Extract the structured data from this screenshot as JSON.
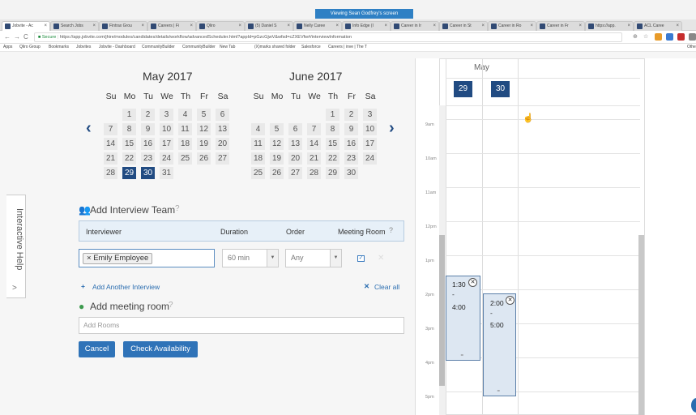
{
  "screen_share": {
    "label": "Viewing Sean Godfrey's screen"
  },
  "browser": {
    "tabs": [
      {
        "title": "Jobvite - Ac",
        "active": true
      },
      {
        "title": "Search Jobs",
        "active": false
      },
      {
        "title": "Fintrax Grou",
        "active": false
      },
      {
        "title": "Careers | Fi",
        "active": false
      },
      {
        "title": "Qliro",
        "active": false
      },
      {
        "title": "(5) Daniel S",
        "active": false
      },
      {
        "title": "Nelly Caree",
        "active": false
      },
      {
        "title": "Info Edge (I",
        "active": false
      },
      {
        "title": "Career in Ir",
        "active": false
      },
      {
        "title": "Career in St",
        "active": false
      },
      {
        "title": "Career in Ro",
        "active": false
      },
      {
        "title": "Career in Fr",
        "active": false
      },
      {
        "title": "https://app.",
        "active": false
      },
      {
        "title": "ACL Caree",
        "active": false
      }
    ],
    "secure_label": "Secure",
    "url": "https://app.jobvite.com/jhire/modules/candidates/details/workflow/advancedScheduler.html?appId=pGzcGjwV&wfsd=cZXEVfw#/interviewInformation",
    "bookmarks": [
      "Apps",
      "Qliro Group",
      "Bookmarks",
      "Jobvites",
      "Jobvite - Dashboard",
      "CommunityBuilder",
      "CommunityBuilder",
      "New Tab",
      "(X)marks shared folder",
      "Salesforce",
      "Careers | inve | The T",
      "Other"
    ]
  },
  "help_tab": {
    "label": "Interactive Help",
    "chevron": ">"
  },
  "calendar": {
    "prev_icon": "‹",
    "next_icon": "›",
    "weekdays": [
      "Su",
      "Mo",
      "Tu",
      "We",
      "Th",
      "Fr",
      "Sa"
    ],
    "months": [
      {
        "title": "May 2017",
        "weeks": [
          [
            "",
            "1",
            "2",
            "3",
            "4",
            "5",
            "6"
          ],
          [
            "7",
            "8",
            "9",
            "10",
            "11",
            "12",
            "13"
          ],
          [
            "14",
            "15",
            "16",
            "17",
            "18",
            "19",
            "20"
          ],
          [
            "21",
            "22",
            "23",
            "24",
            "25",
            "26",
            "27"
          ],
          [
            "28",
            "29",
            "30",
            "31",
            "",
            "",
            ""
          ]
        ],
        "selected": [
          "29",
          "30"
        ]
      },
      {
        "title": "June 2017",
        "weeks": [
          [
            "",
            "",
            "",
            "",
            "1",
            "2",
            "3"
          ],
          [
            "4",
            "5",
            "6",
            "7",
            "8",
            "9",
            "10"
          ],
          [
            "11",
            "12",
            "13",
            "14",
            "15",
            "16",
            "17"
          ],
          [
            "18",
            "19",
            "20",
            "21",
            "22",
            "23",
            "24"
          ],
          [
            "25",
            "26",
            "27",
            "28",
            "29",
            "30",
            ""
          ]
        ],
        "selected": []
      }
    ]
  },
  "interview_team": {
    "title": "Add Interview Team",
    "columns": {
      "interviewer": "Interviewer",
      "duration": "Duration",
      "order": "Order",
      "meeting_room": "Meeting Room"
    },
    "row": {
      "interviewer": "Emily Employee",
      "duration": "60 min",
      "order": "Any",
      "meeting_room_checked": true
    },
    "add_another": "Add Another Interview",
    "clear_all": "Clear all"
  },
  "meeting_room": {
    "title": "Add meeting room",
    "placeholder": "Add Rooms"
  },
  "buttons": {
    "cancel": "Cancel",
    "check_availability": "Check Availability"
  },
  "scheduler": {
    "month": "May",
    "days": [
      "29",
      "30"
    ],
    "hours": [
      "9am",
      "10am",
      "11am",
      "12pm",
      "1pm",
      "2pm",
      "3pm",
      "4pm",
      "5pm"
    ],
    "appointments": [
      {
        "day": "29",
        "start": "1:30",
        "sep": "-",
        "end": "4:00"
      },
      {
        "day": "30",
        "start": "2:00",
        "sep": "-",
        "end": "5:00"
      }
    ]
  },
  "colors": {
    "accent": "#214b82",
    "link": "#2a6db0",
    "selection": "#214b82"
  }
}
